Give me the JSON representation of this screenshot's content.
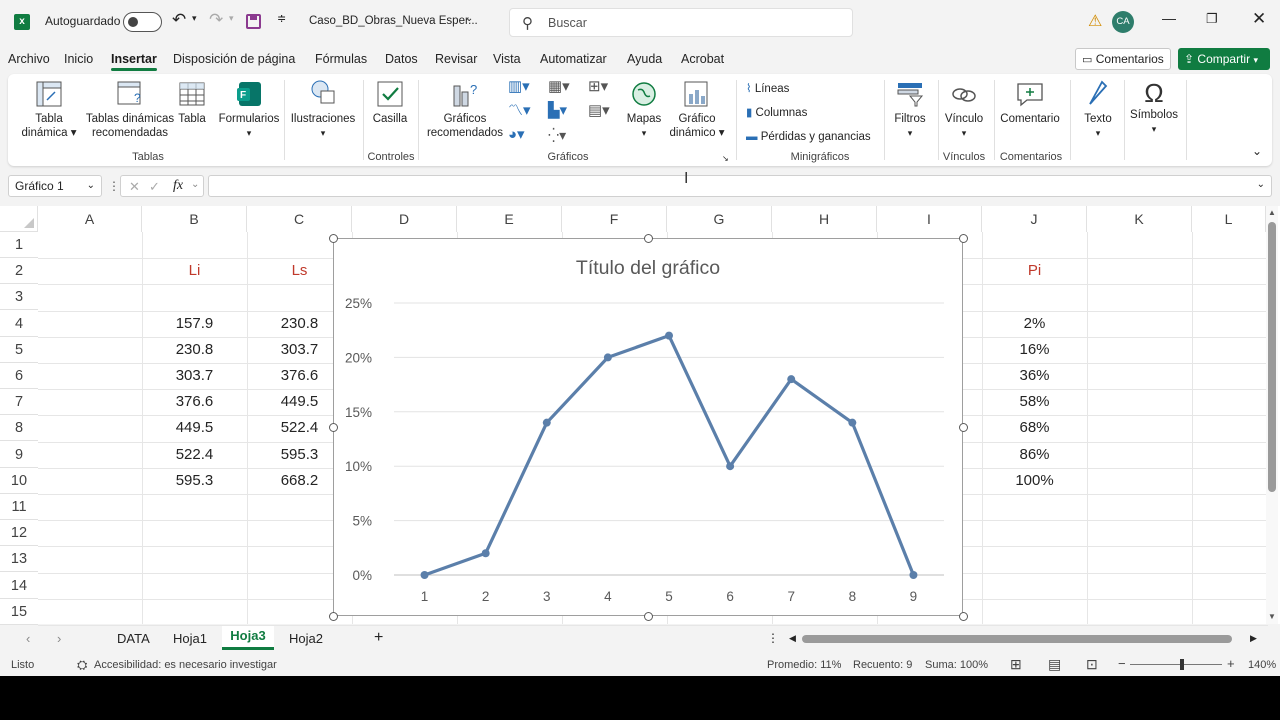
{
  "titlebar": {
    "autosave_label": "Autoguardado",
    "filename": "Caso_BD_Obras_Nueva Esper...",
    "search_placeholder": "Buscar",
    "avatar_initials": "CA"
  },
  "menu": {
    "tabs": [
      "Archivo",
      "Inicio",
      "Insertar",
      "Disposición de página",
      "Fórmulas",
      "Datos",
      "Revisar",
      "Vista",
      "Automatizar",
      "Ayuda",
      "Acrobat"
    ],
    "active": "Insertar",
    "comments_label": "Comentarios",
    "share_label": "Compartir"
  },
  "ribbon": {
    "tabla_dinamica": "Tabla\ndinámica",
    "tablas_recomendadas": "Tablas dinámicas\nrecomendadas",
    "tabla": "Tabla",
    "formularios": "Formularios",
    "group_tablas": "Tablas",
    "ilustraciones": "Ilustraciones",
    "casilla": "Casilla",
    "group_controles": "Controles",
    "graficos_recomendados": "Gráficos\nrecomendados",
    "mapas": "Mapas",
    "grafico_dinamico": "Gráfico\ndinámico",
    "group_graficos": "Gráficos",
    "lineas": "Líneas",
    "columnas": "Columnas",
    "perdidas": "Pérdidas y ganancias",
    "group_minigraficos": "Minigráficos",
    "filtros": "Filtros",
    "vinculo": "Vínculo",
    "group_vinculos": "Vínculos",
    "comentario": "Comentario",
    "group_comentarios": "Comentarios",
    "texto": "Texto",
    "simbolos": "Símbolos"
  },
  "formulabar": {
    "namebox": "Gráfico 1",
    "fx": "fx",
    "formula": ""
  },
  "grid": {
    "columns": [
      "A",
      "B",
      "C",
      "D",
      "E",
      "F",
      "G",
      "H",
      "I",
      "J",
      "K",
      "L"
    ],
    "rows": [
      "1",
      "2",
      "3",
      "4",
      "5",
      "6",
      "7",
      "8",
      "9",
      "10",
      "11",
      "12",
      "13",
      "14",
      "15"
    ],
    "li_header": "Li",
    "ls_header": "Ls",
    "pi_header": "Pi",
    "li": [
      "157.9",
      "230.8",
      "303.7",
      "376.6",
      "449.5",
      "522.4",
      "595.3"
    ],
    "ls": [
      "230.8",
      "303.7",
      "376.6",
      "449.5",
      "522.4",
      "595.3",
      "668.2"
    ],
    "pi": [
      "2%",
      "16%",
      "36%",
      "58%",
      "68%",
      "86%",
      "100%"
    ]
  },
  "chart_data": {
    "type": "line",
    "title": "Título del gráfico",
    "categories": [
      "1",
      "2",
      "3",
      "4",
      "5",
      "6",
      "7",
      "8",
      "9"
    ],
    "values": [
      0,
      2,
      14,
      20,
      22,
      10,
      18,
      14,
      0
    ],
    "y_ticks": [
      "0%",
      "5%",
      "10%",
      "15%",
      "20%",
      "25%"
    ],
    "ylim": [
      0,
      25
    ],
    "xlabel": "",
    "ylabel": "",
    "color": "#5b7faa",
    "grid": true
  },
  "sheets": {
    "tabs": [
      "DATA",
      "Hoja1",
      "Hoja3",
      "Hoja2"
    ],
    "active": "Hoja3"
  },
  "status": {
    "ready": "Listo",
    "accessibility": "Accesibilidad: es necesario investigar",
    "average": "Promedio: 11%",
    "count": "Recuento: 9",
    "sum": "Suma: 100%",
    "zoom": "140%"
  },
  "colors": {
    "accent": "#107c41",
    "header_red": "#c0392b"
  }
}
